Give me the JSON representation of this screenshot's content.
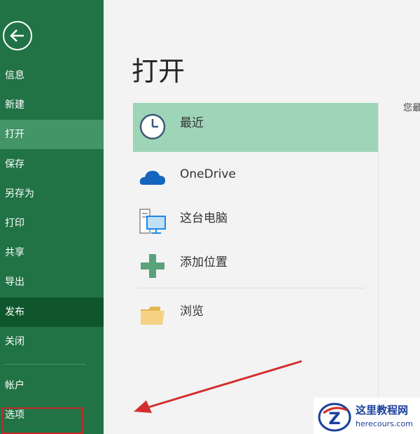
{
  "sidebar": {
    "back_icon": "back-arrow-icon",
    "items": [
      {
        "label": "信息"
      },
      {
        "label": "新建"
      },
      {
        "label": "打开"
      },
      {
        "label": "保存"
      },
      {
        "label": "另存为"
      },
      {
        "label": "打印"
      },
      {
        "label": "共享"
      },
      {
        "label": "导出"
      },
      {
        "label": "发布"
      },
      {
        "label": "关闭"
      },
      {
        "label": "帐户"
      },
      {
        "label": "选项"
      }
    ],
    "active_item": "打开",
    "highlighted_item": "选项"
  },
  "main": {
    "title": "打开",
    "locations": [
      {
        "label": "最近",
        "icon": "clock-icon"
      },
      {
        "label": "OneDrive",
        "icon": "cloud-icon"
      },
      {
        "label": "这台电脑",
        "icon": "computer-icon"
      },
      {
        "label": "添加位置",
        "icon": "plus-icon"
      },
      {
        "label": "浏览",
        "icon": "folder-icon"
      }
    ],
    "recent_hint": "您最"
  },
  "watermark": {
    "name": "这里教程网",
    "url": "herecours.com"
  },
  "colors": {
    "sidebar": "#217346",
    "sidebar_active": "#439467",
    "sidebar_dark": "#10562d",
    "selected_location": "#9fd5b7",
    "annotation": "#c62828"
  }
}
